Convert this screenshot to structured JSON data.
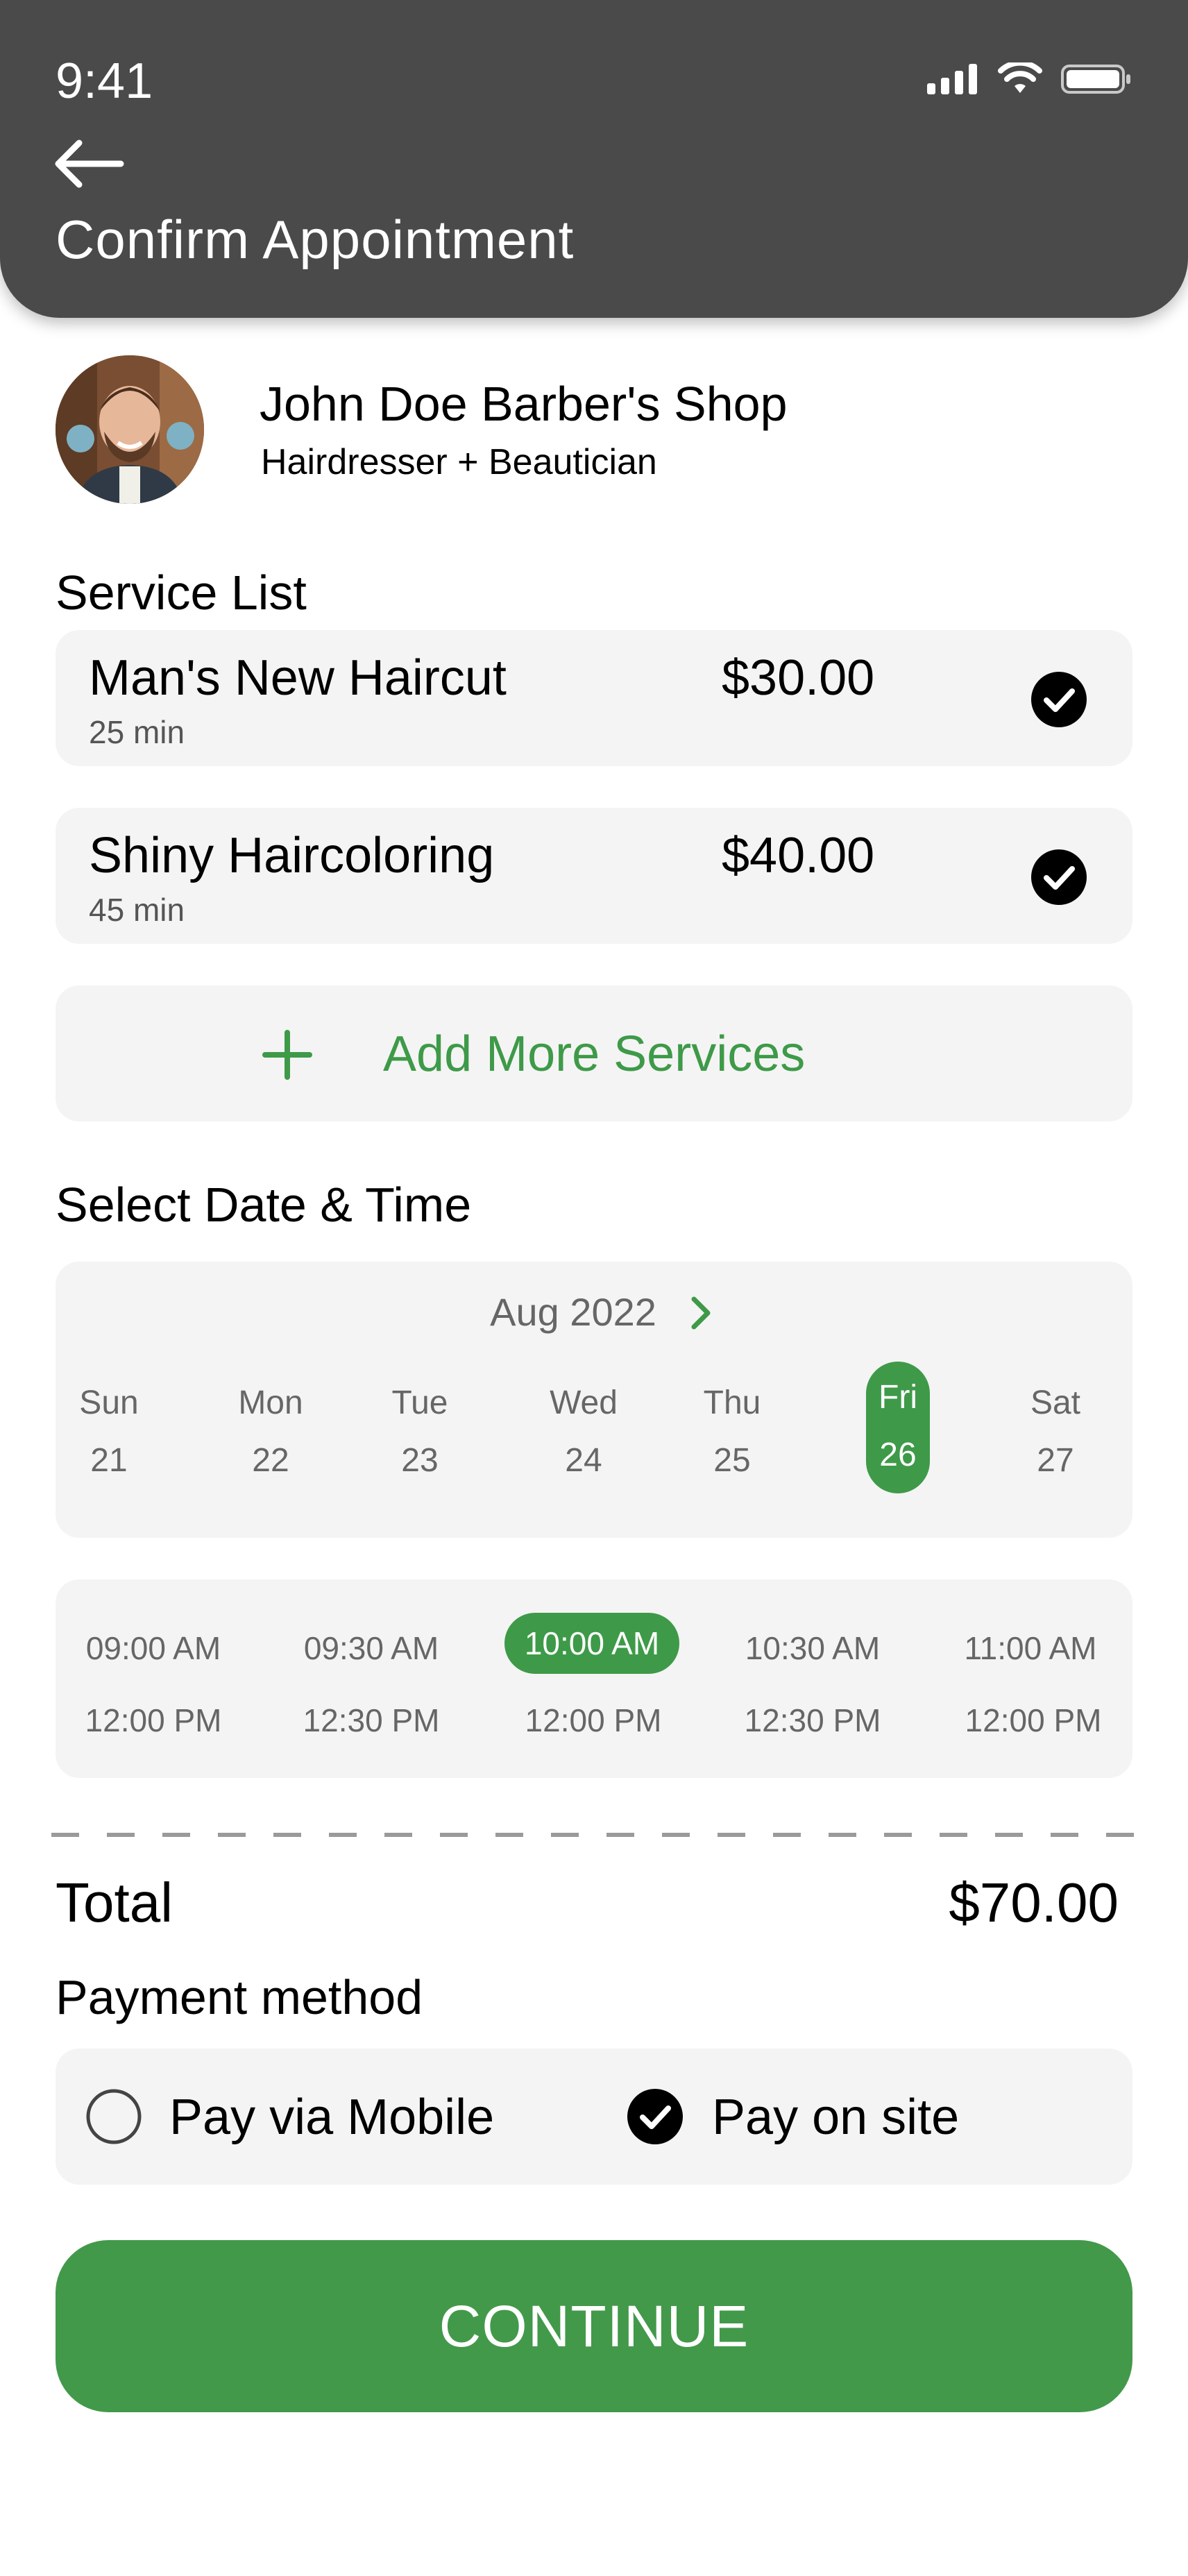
{
  "status_bar": {
    "time": "9:41"
  },
  "header": {
    "title": "Confirm Appointment"
  },
  "shop": {
    "name": "John Doe Barber's Shop",
    "subtitle": "Hairdresser + Beautician"
  },
  "services": {
    "title": "Service List",
    "items": [
      {
        "name": "Man's New Haircut",
        "duration": "25 min",
        "price": "$30.00",
        "checked": true
      },
      {
        "name": "Shiny Haircoloring",
        "duration": "45 min",
        "price": "$40.00",
        "checked": true
      }
    ],
    "add_label": "Add More Services"
  },
  "schedule": {
    "title": "Select Date & Time",
    "month": "Aug 2022",
    "days": [
      {
        "name": "Sun",
        "date": "21"
      },
      {
        "name": "Mon",
        "date": "22"
      },
      {
        "name": "Tue",
        "date": "23"
      },
      {
        "name": "Wed",
        "date": "24"
      },
      {
        "name": "Thu",
        "date": "25"
      },
      {
        "name": "Fri",
        "date": "26",
        "selected": true
      },
      {
        "name": "Sat",
        "date": "27"
      }
    ],
    "slots_row1": [
      "09:00 AM",
      "09:30 AM",
      "10:00 AM",
      "10:30 AM",
      "11:00 AM"
    ],
    "slots_row2": [
      "12:00 PM",
      "12:30 PM",
      "12:00 PM",
      "12:30 PM",
      "12:00 PM"
    ],
    "selected_slot": "10:00 AM"
  },
  "total": {
    "label": "Total",
    "value": "$70.00"
  },
  "payment": {
    "title": "Payment method",
    "options": [
      {
        "label": "Pay via Mobile",
        "selected": false
      },
      {
        "label": "Pay on site",
        "selected": true
      }
    ]
  },
  "cta": {
    "label": "CONTINUE"
  },
  "colors": {
    "accent": "#3e9a48",
    "header_bg": "#4a4a4a",
    "card_bg": "#f4f4f4"
  }
}
